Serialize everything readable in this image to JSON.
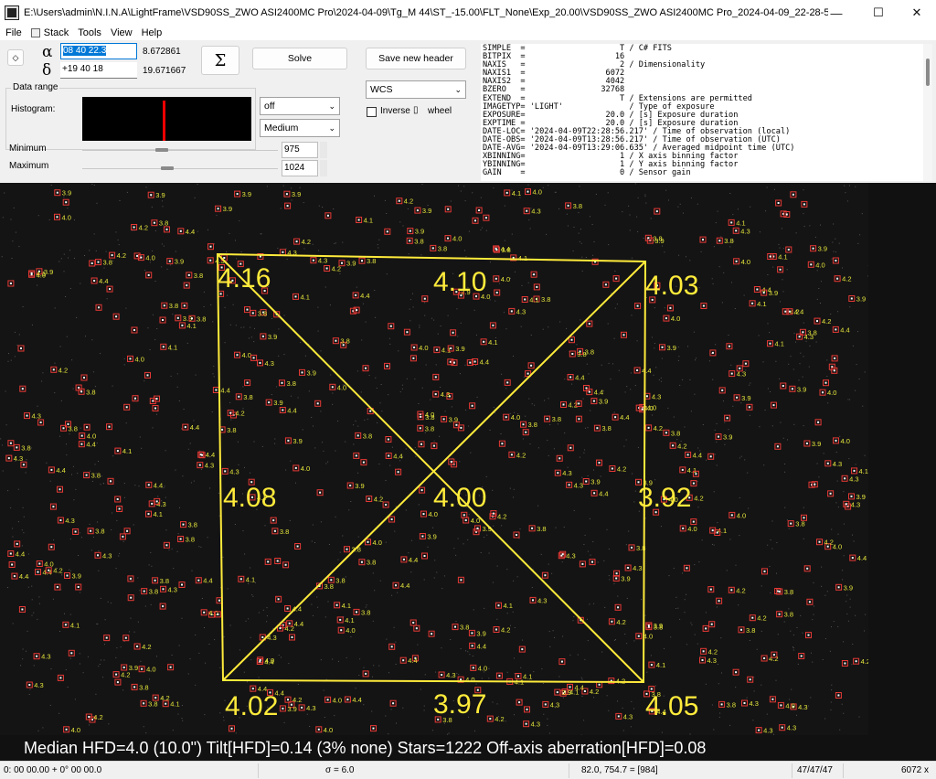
{
  "window": {
    "title": "E:\\Users\\admin\\N.I.N.A\\LightFrame\\VSD90SS_ZWO ASI2400MC Pro\\2024-04-09\\Tg_M 44\\ST_-15.00\\FLT_None\\Exp_20.00\\VSD90SS_ZWO ASI2400MC Pro_2024-04-09_22-28-56_M 44_G0_..."
  },
  "menu": [
    "File",
    "Stack",
    "Tools",
    "View",
    "Help"
  ],
  "coords": {
    "alpha_symbol": "α",
    "delta_symbol": "δ",
    "ra_value": "08 40 22.3",
    "dec_value": "+19 40 18",
    "ra_deg": "8.672861",
    "dec_deg": "19.671667"
  },
  "buttons": {
    "sigma": "Σ",
    "solve": "Solve",
    "save_header": "Save new header"
  },
  "data_range": {
    "legend": "Data range",
    "histogram_label": "Histogram:",
    "stretch_value": "off",
    "gamma_value": "Medium",
    "minimum_label": "Minimum",
    "maximum_label": "Maximum",
    "minimum_value": "975",
    "maximum_value": "1024"
  },
  "wcs": {
    "mode": "WCS",
    "inverse_label": "Inverse",
    "wheel_label": "wheel"
  },
  "fits_header": [
    "SIMPLE  =                    T / C# FITS",
    "BITPIX  =                   16",
    "NAXIS   =                    2 / Dimensionality",
    "NAXIS1  =                 6072",
    "NAXIS2  =                 4042",
    "BZERO   =                32768",
    "EXTEND  =                    T / Extensions are permitted",
    "IMAGETYP= 'LIGHT'              / Type of exposure",
    "EXPOSURE=                 20.0 / [s] Exposure duration",
    "EXPTIME =                 20.0 / [s] Exposure duration",
    "DATE-LOC= '2024-04-09T22:28:56.217' / Time of observation (local)",
    "DATE-OBS= '2024-04-09T13:28:56.217' / Time of observation (UTC)",
    "DATE-AVG= '2024-04-09T13:29:06.635' / Averaged midpoint time (UTC)",
    "XBINNING=                    1 / X axis binning factor",
    "YBINNING=                    1 / Y axis binning factor",
    "GAIN    =                    0 / Sensor gain"
  ],
  "hfd_grid": {
    "top_left": "4.16",
    "top_center": "4.10",
    "top_right": "4.03",
    "mid_left": "4.08",
    "center": "4.00",
    "mid_right": "3.92",
    "bottom_left": "4.02",
    "bottom_center": "3.97",
    "bottom_right": "4.05"
  },
  "summary": "Median HFD=4.0 (10.0\")  Tilt[HFD]=0.14 (3% none)  Stars=1222  Off-axis aberration[HFD]=0.08",
  "status": {
    "position": "0: 00  00.00   + 0° 00  00.0",
    "sigma": "σ = 6.0",
    "pixel": "82.0, 754.7 = [984]",
    "rgb": "47/47/47",
    "size": "6072 x"
  },
  "colors": {
    "overlay": "#ffeb3b",
    "star_marker": "#e53935",
    "label": "#e6e63c"
  }
}
